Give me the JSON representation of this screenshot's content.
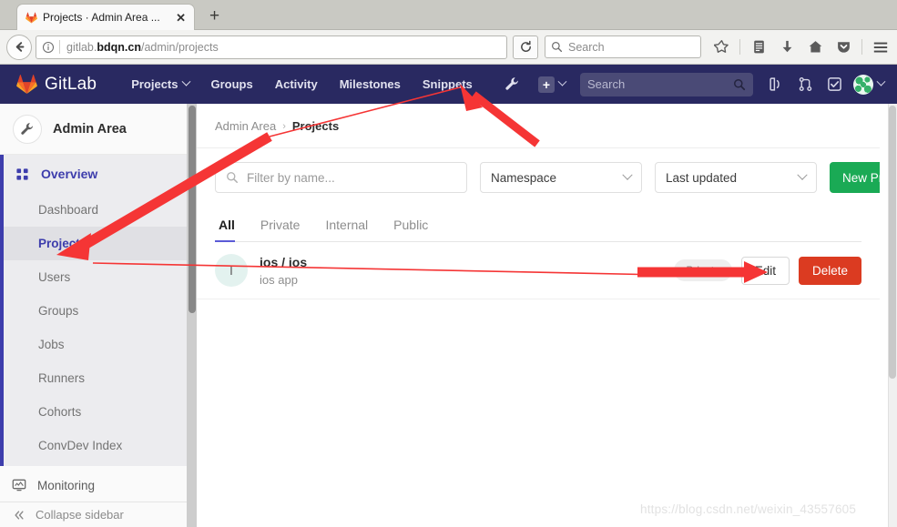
{
  "browser": {
    "tab": {
      "title": "Projects · Admin Area ...",
      "favicon": "gitlab-fox-icon",
      "close_label": "✕"
    },
    "new_tab_label": "+",
    "url": {
      "scheme_host_prefix": "gitlab.",
      "host_bold": "bdqn.cn",
      "path": "/admin/projects"
    },
    "search_placeholder": "Search",
    "toolbar_icons": [
      "bookmark-star-icon",
      "library-icon",
      "downloads-icon",
      "home-icon",
      "pocket-icon",
      "hamburger-menu-icon"
    ],
    "back_icon": "back-arrow-icon",
    "info_icon": "page-info-icon",
    "reload_icon": "reload-icon"
  },
  "gitlab_header": {
    "brand": "GitLab",
    "nav": [
      {
        "label": "Projects",
        "has_caret": true
      },
      {
        "label": "Groups",
        "has_caret": false
      },
      {
        "label": "Activity",
        "has_caret": false
      },
      {
        "label": "Milestones",
        "has_caret": false
      },
      {
        "label": "Snippets",
        "has_caret": false
      }
    ],
    "admin_icon": "wrench-icon",
    "plus_label": "+",
    "search_placeholder": "Search",
    "right_icons": [
      "issues-icon",
      "merge-requests-icon",
      "todos-icon"
    ],
    "avatar": "user-avatar",
    "brand_bg": "#292961",
    "search_bg": "#4a4a76"
  },
  "sidebar": {
    "header": {
      "title": "Admin Area",
      "icon": "wrench-icon"
    },
    "section": {
      "label": "Overview",
      "icon": "grid-overview-icon"
    },
    "items": [
      {
        "label": "Dashboard",
        "active": false
      },
      {
        "label": "Projects",
        "active": true
      },
      {
        "label": "Users",
        "active": false
      },
      {
        "label": "Groups",
        "active": false
      },
      {
        "label": "Jobs",
        "active": false
      },
      {
        "label": "Runners",
        "active": false
      },
      {
        "label": "Cohorts",
        "active": false
      },
      {
        "label": "ConvDev Index",
        "active": false
      }
    ],
    "monitoring": {
      "label": "Monitoring",
      "icon": "monitor-icon"
    },
    "collapse": {
      "label": "Collapse sidebar",
      "icon": "double-chevron-left-icon"
    },
    "active_color": "#3d3dac"
  },
  "breadcrumb": {
    "parent": "Admin Area",
    "separator": "›",
    "current": "Projects"
  },
  "filters": {
    "search_placeholder": "Filter by name...",
    "search_value": "",
    "namespace_label": "Namespace",
    "sort_label": "Last updated",
    "new_project_label": "New Project",
    "new_project_color": "#1aaa55"
  },
  "tabs": [
    {
      "label": "All",
      "active": true
    },
    {
      "label": "Private",
      "active": false
    },
    {
      "label": "Internal",
      "active": false
    },
    {
      "label": "Public",
      "active": false
    }
  ],
  "projects": [
    {
      "avatar_letter": "I",
      "title": "ios / ios",
      "description": "ios app",
      "visibility": "Private",
      "edit_label": "Edit",
      "delete_label": "Delete"
    }
  ],
  "watermark": "https://blog.csdn.net/weixin_43557605",
  "annotations": {
    "color": "#f53535",
    "arrows": [
      "arrow-to-projects-sidebar",
      "arrow-to-admin-wrench",
      "line-from-projects-to-edit"
    ]
  }
}
